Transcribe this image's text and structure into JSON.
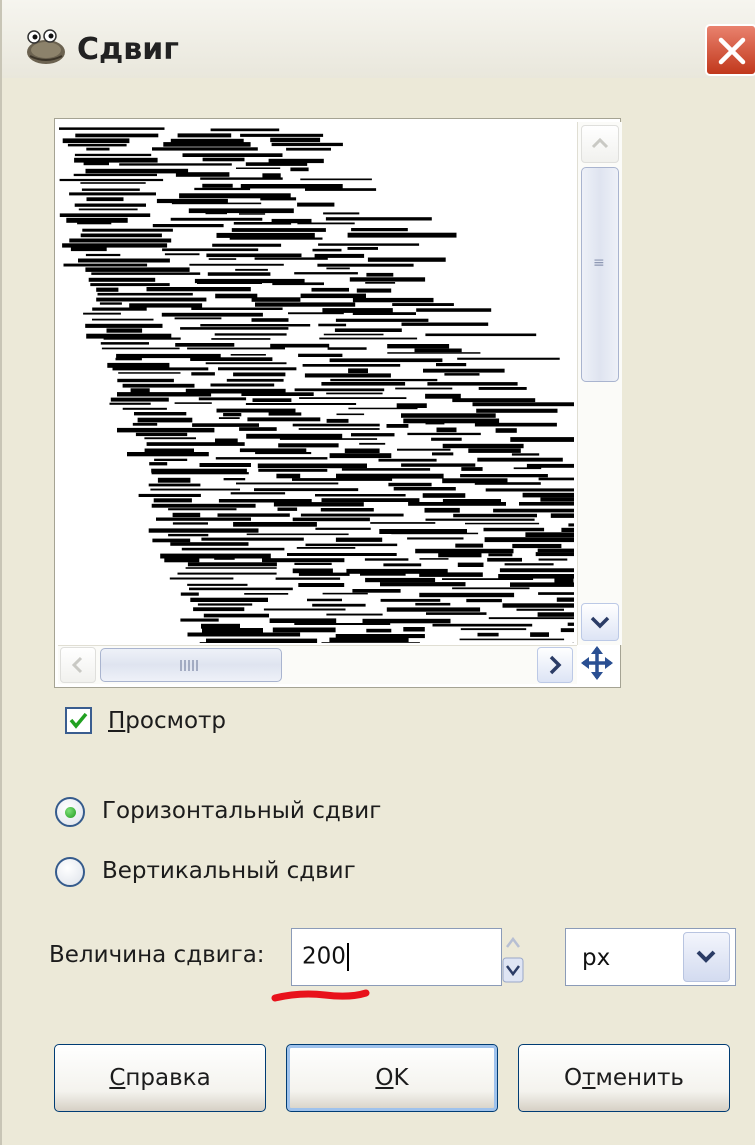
{
  "window": {
    "title": "Сдвиг",
    "close_icon": "close-icon",
    "app_icon": "gimp-wilber-icon"
  },
  "preview": {
    "checkbox_label": "Просмотр",
    "checked": true,
    "move_icon": "move-arrows-icon"
  },
  "shift_direction": {
    "options": [
      {
        "label": "Горизонтальный сдвиг",
        "selected": true
      },
      {
        "label": "Вертикальный сдвиг",
        "selected": false
      }
    ]
  },
  "amount": {
    "label": "Величина сдвига:",
    "value": "200",
    "unit": "px"
  },
  "buttons": {
    "help": "Справка",
    "ok": "OK",
    "cancel": "Отменить"
  },
  "colors": {
    "dialog_bg": "#ece9d8",
    "close_button": "#c1381c",
    "annotation_underline": "#e8121b",
    "radio_dot": "#1f9b1f"
  }
}
